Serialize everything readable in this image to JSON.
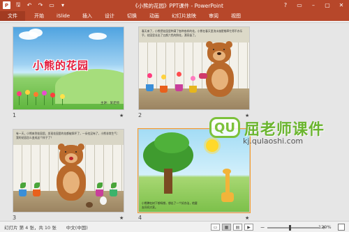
{
  "titlebar": {
    "title": "《小熊的花园》PPT课件 - PowerPoint",
    "app_logo": "P",
    "qat": [
      "save-icon",
      "undo-icon",
      "redo-icon",
      "start-slideshow-icon",
      "customize-icon"
    ],
    "window_buttons": [
      "?",
      "▭",
      "–",
      "▢",
      "✕"
    ]
  },
  "ribbon": {
    "tabs": [
      "文件",
      "开始",
      "iSlide",
      "插入",
      "设计",
      "切换",
      "动画",
      "幻灯片放映",
      "审阅",
      "视图"
    ]
  },
  "slides": [
    {
      "number": "1",
      "title": "小熊的花园",
      "author": "主讲：某老师"
    },
    {
      "number": "2",
      "caption": "春天来了，小熊把花园里种满了各种各样的花，小熊在春天里浇水施肥锄草忙得不亦乐乎，花园里长出了五颜六色的鲜花，漂亮极了。"
    },
    {
      "number": "3",
      "caption": "有一天，小熊来到花园里，发现花园里的花都被踩坏了，一朵也没有了，小熊非常生气：我的花园怎么变成这个样子了？"
    },
    {
      "number": "4",
      "caption": "小熊蹲在树下想呀想，想出了一个好办法，他要去问问大家。"
    }
  ],
  "watermark": {
    "logo_text": "QU",
    "name": "屈老师课件",
    "url": "kj.qulaoshi.com"
  },
  "statusbar": {
    "slide_info": "幻灯片 第 4 张，共 10 张",
    "language": "中文(中国)",
    "zoom": "120%",
    "zoom_level_fraction": 0.42
  },
  "colors": {
    "accent": "#b7472a",
    "watermark_green": "#6bb52f"
  }
}
